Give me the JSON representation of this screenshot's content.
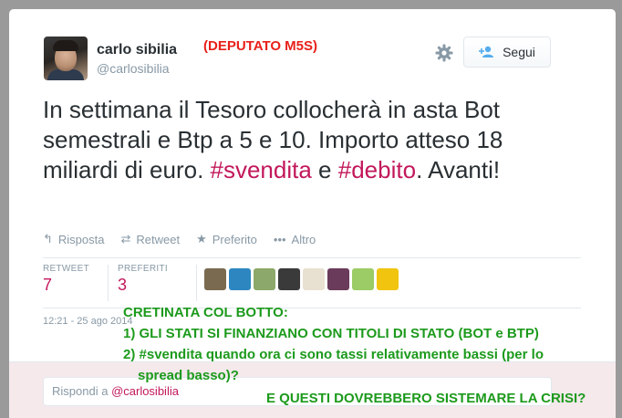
{
  "user": {
    "name": "carlo sibilia",
    "handle": "@carlosibilia"
  },
  "follow_button": {
    "label": "Segui"
  },
  "tweet": {
    "segments": [
      {
        "text": "In settimana il Tesoro collocherà in asta Bot semestrali e Btp a 5 e 10. Importo atteso 18 miliardi di euro. ",
        "hashtag": false
      },
      {
        "text": "#svendita",
        "hashtag": true
      },
      {
        "text": " e ",
        "hashtag": false
      },
      {
        "text": "#debito",
        "hashtag": true
      },
      {
        "text": ". Avanti!",
        "hashtag": false
      }
    ]
  },
  "actions": [
    {
      "name": "reply",
      "label": "Risposta",
      "glyph": "↰"
    },
    {
      "name": "retweet",
      "label": "Retweet",
      "glyph": "⇄"
    },
    {
      "name": "favorite",
      "label": "Preferito",
      "glyph": "★"
    },
    {
      "name": "more",
      "label": "Altro",
      "glyph": "•••"
    }
  ],
  "stats": {
    "retweet_label": "RETWEET",
    "retweet_count": "7",
    "favorites_label": "PREFERITI",
    "favorites_count": "3"
  },
  "favoriters": [
    {
      "name": "favoriter-1",
      "color": "#7a6a4f"
    },
    {
      "name": "favoriter-2",
      "color": "#2e86c1"
    },
    {
      "name": "favoriter-3",
      "color": "#8ca86a"
    },
    {
      "name": "favoriter-4",
      "color": "#3a3a3a"
    },
    {
      "name": "favoriter-5",
      "color": "#e8e0d0"
    },
    {
      "name": "favoriter-6",
      "color": "#6a3b5a"
    },
    {
      "name": "favoriter-7",
      "color": "#9ccc65"
    },
    {
      "name": "favoriter-8",
      "color": "#f1c40f"
    }
  ],
  "timestamp": "12:21 - 25 ago 2014",
  "reply": {
    "placeholder": "Rispondi a",
    "mention": "@carlosibilia"
  },
  "annotations": {
    "deputato": "(DEPUTATO M5S)",
    "title": "CRETINATA COL BOTTO:",
    "point1": "1) GLI STATI SI FINANZIANO CON TITOLI DI STATO (BOT e BTP)",
    "point2_line1": "2) #svendita quando ora ci sono tassi relativamente bassi (per lo",
    "point2_line2": "spread basso)?",
    "closing": "E QUESTI DOVREBBERO SISTEMARE LA CRISI?"
  }
}
